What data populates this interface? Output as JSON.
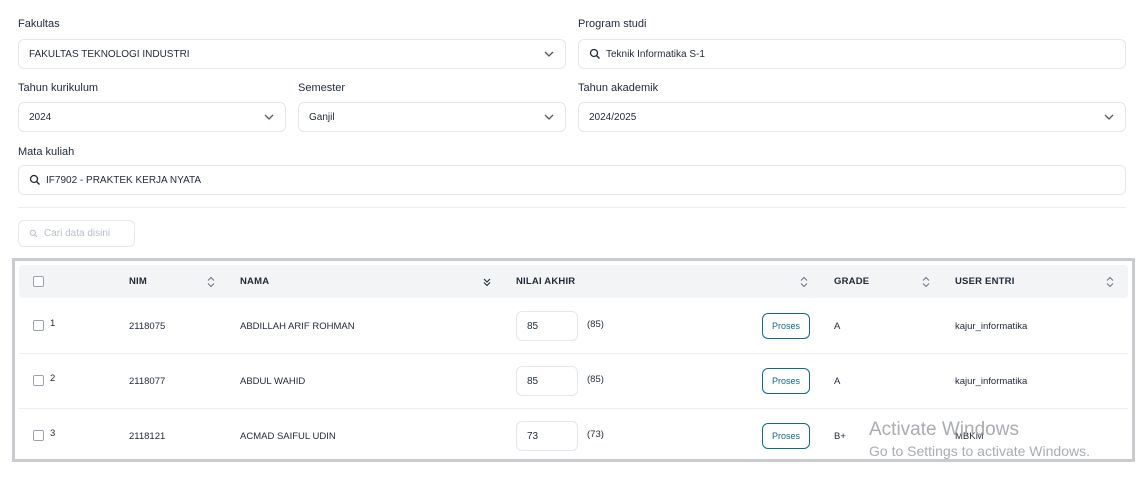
{
  "form": {
    "fakultas": {
      "label": "Fakultas",
      "value": "FAKULTAS TEKNOLOGI INDUSTRI"
    },
    "program_studi": {
      "label": "Program studi",
      "value": "Teknik Informatika S-1"
    },
    "tahun_kurikulum": {
      "label": "Tahun kurikulum",
      "value": "2024"
    },
    "semester": {
      "label": "Semester",
      "value": "Ganjil"
    },
    "tahun_akademik": {
      "label": "Tahun akademik",
      "value": "2024/2025"
    },
    "mata_kuliah": {
      "label": "Mata kuliah",
      "value": "IF7902 - PRAKTEK KERJA NYATA"
    }
  },
  "search": {
    "placeholder": "Cari data disini"
  },
  "table": {
    "headers": {
      "nim": "NIM",
      "nama": "NAMA",
      "nilai_akhir": "NILAI AKHIR",
      "grade": "GRADE",
      "user_entri": "USER ENTRI"
    },
    "rows": [
      {
        "no": "1",
        "nim": "2118075",
        "nama": "ABDILLAH ARIF ROHMAN",
        "nilai": "85",
        "nilai_paren": "(85)",
        "proses": "Proses",
        "grade": "A",
        "user_entri": "kajur_informatika"
      },
      {
        "no": "2",
        "nim": "2118077",
        "nama": "ABDUL WAHID",
        "nilai": "85",
        "nilai_paren": "(85)",
        "proses": "Proses",
        "grade": "A",
        "user_entri": "kajur_informatika"
      },
      {
        "no": "3",
        "nim": "2118121",
        "nama": "ACMAD SAIFUL UDIN",
        "nilai": "73",
        "nilai_paren": "(73)",
        "proses": "Proses",
        "grade": "B+",
        "user_entri": "MBKM"
      }
    ]
  },
  "watermark": {
    "line1": "Activate Windows",
    "line2": "Go to Settings to activate Windows."
  },
  "colors": {
    "accent": "#0f6a8b",
    "border": "#e5e7eb",
    "header_bg": "#f3f4f6"
  }
}
